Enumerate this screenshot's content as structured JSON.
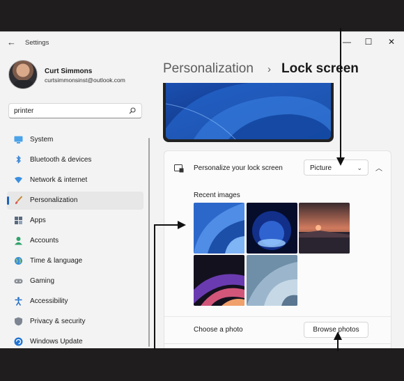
{
  "titlebar": {
    "app_title": "Settings",
    "back_icon": "back-arrow-icon",
    "minimize_glyph": "—",
    "maximize_glyph": "☐",
    "close_glyph": "✕"
  },
  "profile": {
    "name": "Curt Simmons",
    "email": "curtsimmonsinst@outlook.com"
  },
  "search": {
    "value": "printer",
    "icon": "search-icon"
  },
  "sidebar": {
    "items": [
      {
        "label": "System",
        "icon": "system-icon",
        "selected": false
      },
      {
        "label": "Bluetooth & devices",
        "icon": "bluetooth-icon",
        "selected": false
      },
      {
        "label": "Network & internet",
        "icon": "network-icon",
        "selected": false
      },
      {
        "label": "Personalization",
        "icon": "brush-icon",
        "selected": true
      },
      {
        "label": "Apps",
        "icon": "apps-icon",
        "selected": false
      },
      {
        "label": "Accounts",
        "icon": "person-icon",
        "selected": false
      },
      {
        "label": "Time & language",
        "icon": "globe-icon",
        "selected": false
      },
      {
        "label": "Gaming",
        "icon": "gamepad-icon",
        "selected": false
      },
      {
        "label": "Accessibility",
        "icon": "accessibility-icon",
        "selected": false
      },
      {
        "label": "Privacy & security",
        "icon": "shield-icon",
        "selected": false
      },
      {
        "label": "Windows Update",
        "icon": "update-icon",
        "selected": false
      }
    ]
  },
  "header": {
    "parent": "Personalization",
    "separator": "›",
    "current": "Lock screen"
  },
  "lock_screen": {
    "personalize_label": "Personalize your lock screen",
    "personalize_value": "Picture",
    "recent_images_label": "Recent images",
    "choose_photo_label": "Choose a photo",
    "browse_button": "Browse photos"
  },
  "colors": {
    "accent": "#1e63b8",
    "window_bg": "#f3f3f3",
    "card_bg": "#fbfbfb",
    "frame": "#1f1d1d"
  }
}
